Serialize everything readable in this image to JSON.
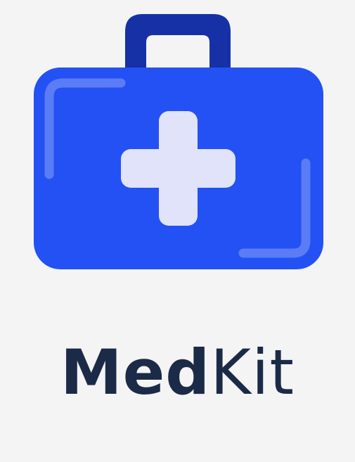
{
  "logo": {
    "icon": "medical-kit-icon",
    "colors": {
      "case_body": "#2351f3",
      "handle": "#1631a6",
      "cross": "#e0e3fa",
      "highlight": "#5b7cf7"
    }
  },
  "brand": {
    "name_bold": "Med",
    "name_light": "Kit",
    "text_color": "#1b2a47"
  }
}
